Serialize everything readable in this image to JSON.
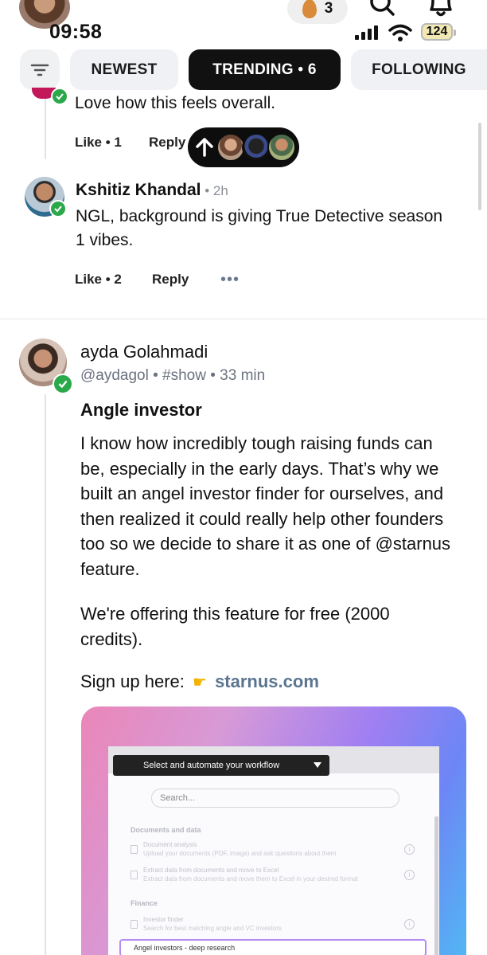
{
  "status_bar": {
    "time": "09:58",
    "egg_count": "3",
    "battery": "124"
  },
  "tabs": {
    "items": [
      {
        "label": "NEWEST",
        "active": false
      },
      {
        "label": "TRENDING • 6",
        "active": true
      },
      {
        "label": "FOLLOWING",
        "active": false
      }
    ]
  },
  "thread": {
    "clipped_comment_text": "Love how this feels overall.",
    "clipped_like": "Like • 1",
    "clipped_reply": "Reply",
    "comment": {
      "author": "Kshitiz Khandal",
      "time": " • 2h",
      "text": "NGL, background is giving True Detective season 1 vibes.",
      "like": "Like • 2",
      "reply": "Reply",
      "more": "•••"
    }
  },
  "post": {
    "author": "ayda Golahmadi",
    "meta": "@aydagol • #show • 33 min",
    "title": "Angle investor",
    "paragraph1": "I know how incredibly tough raising funds can be, especially in the early days. That’s why we built an angel investor finder for ourselves, and then realized it could really help other founders too so we decide to share it as one of @starnus feature.",
    "paragraph2": "We're offering this feature for free (2000 credits).",
    "signup_prefix": "Sign up here:",
    "signup_link": "starnus.com",
    "embed": {
      "dropdown": "Select and automate your workflow",
      "search_placeholder": "Search...",
      "section_docs": "Documents and data",
      "item1_title": "Document analysis",
      "item1_sub": "Upload your documents (PDF, image) and ask questions about them",
      "item2_title": "Extract data from documents and move to Excel",
      "item2_sub": "Extract data from documents and move them to Excel in your desired format",
      "section_finance": "Finance",
      "item3_title": "Investor finder",
      "item3_sub": "Search for best matching angle and VC investors",
      "selected_item": "Angel investors - deep research"
    }
  },
  "colors": {
    "accent_link": "#5b7590",
    "verified_badge": "#2aa84a",
    "active_tab": "#111111"
  }
}
